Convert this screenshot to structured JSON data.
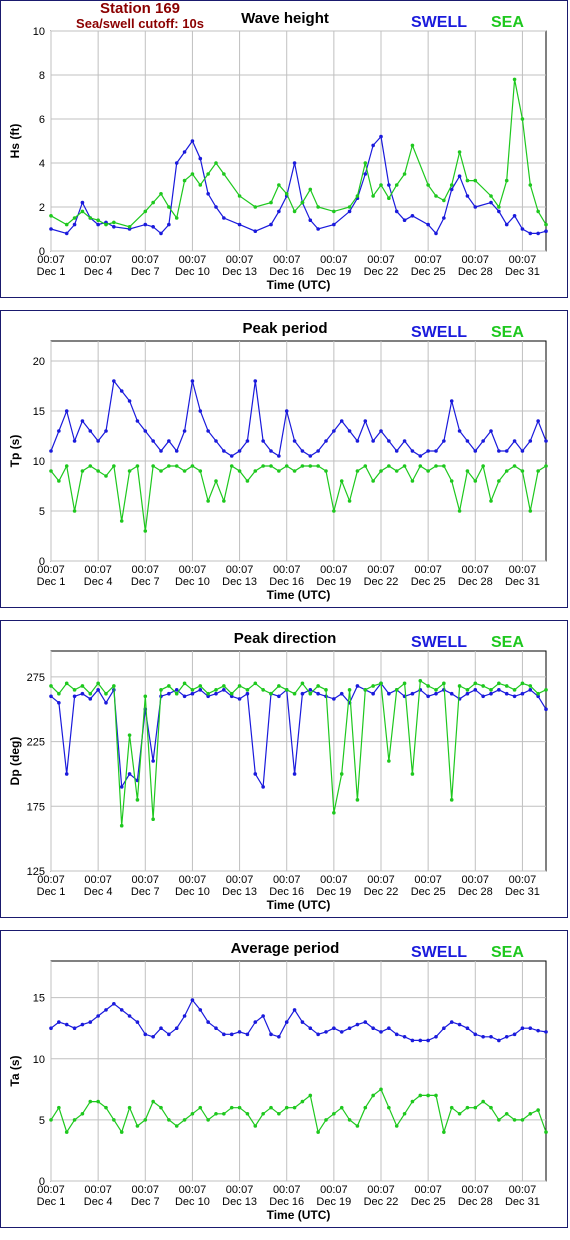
{
  "header": {
    "station": "Station 169",
    "cutoff": "Sea/swell cutoff: 10s"
  },
  "colors": {
    "swell": "#1a1adc",
    "sea": "#1ec81e",
    "frame": "#1a1a6e",
    "station": "#8b0000"
  },
  "legend": {
    "swell": "SWELL",
    "sea": "SEA"
  },
  "x_axis": {
    "label": "Time (UTC)",
    "tick_times": [
      "00:07",
      "00:07",
      "00:07",
      "00:07",
      "00:07",
      "00:07",
      "00:07",
      "00:07",
      "00:07",
      "00:07",
      "00:07"
    ],
    "tick_dates": [
      "Dec 1",
      "Dec 4",
      "Dec 7",
      "Dec 10",
      "Dec 13",
      "Dec 16",
      "Dec 19",
      "Dec 22",
      "Dec 25",
      "Dec 28",
      "Dec 31"
    ],
    "tick_days": [
      0,
      3,
      6,
      9,
      12,
      15,
      18,
      21,
      24,
      27,
      30
    ],
    "range_days": [
      0,
      31.5
    ]
  },
  "chart_data": [
    {
      "type": "line",
      "title": "Wave height",
      "ylabel": "Hs (ft)",
      "ylim": [
        0,
        10
      ],
      "yticks": [
        0,
        2,
        4,
        6,
        8,
        10
      ],
      "grid": true,
      "legend_position": "top-right",
      "x_days": [
        0,
        1,
        1.5,
        2,
        2.5,
        3,
        3.5,
        4,
        5,
        6,
        6.5,
        7,
        7.5,
        8,
        8.5,
        9,
        9.5,
        10,
        10.5,
        11,
        12,
        13,
        14,
        14.5,
        15,
        15.5,
        16,
        16.5,
        17,
        18,
        19,
        19.5,
        20,
        20.5,
        21,
        21.5,
        22,
        22.5,
        23,
        24,
        24.5,
        25,
        25.5,
        26,
        26.5,
        27,
        28,
        28.5,
        29,
        29.5,
        30,
        30.5,
        31,
        31.5
      ],
      "series": [
        {
          "name": "SWELL",
          "values": [
            1.0,
            0.8,
            1.2,
            2.2,
            1.5,
            1.2,
            1.3,
            1.1,
            1.0,
            1.2,
            1.1,
            0.8,
            1.2,
            4.0,
            4.5,
            5.0,
            4.2,
            2.6,
            2.0,
            1.5,
            1.2,
            0.9,
            1.2,
            1.8,
            2.5,
            4.0,
            2.2,
            1.4,
            1.0,
            1.2,
            1.8,
            2.4,
            3.5,
            4.8,
            5.2,
            3.0,
            1.8,
            1.4,
            1.6,
            1.2,
            0.8,
            1.5,
            2.8,
            3.4,
            2.5,
            2.0,
            2.2,
            1.8,
            1.2,
            1.6,
            1.0,
            0.8,
            0.8,
            0.9
          ]
        },
        {
          "name": "SEA",
          "values": [
            1.6,
            1.2,
            1.5,
            1.8,
            1.5,
            1.4,
            1.2,
            1.3,
            1.1,
            1.8,
            2.2,
            2.6,
            2.0,
            1.5,
            3.2,
            3.5,
            3.0,
            3.5,
            4.0,
            3.5,
            2.5,
            2.0,
            2.2,
            3.0,
            2.6,
            1.8,
            2.2,
            2.8,
            2.0,
            1.8,
            2.0,
            2.5,
            4.0,
            2.5,
            3.0,
            2.4,
            3.0,
            3.5,
            4.8,
            3.0,
            2.5,
            2.3,
            3.0,
            4.5,
            3.2,
            3.2,
            2.5,
            2.0,
            3.2,
            7.8,
            6.0,
            3.0,
            1.8,
            1.2
          ]
        }
      ]
    },
    {
      "type": "line",
      "title": "Peak period",
      "ylabel": "Tp (s)",
      "ylim": [
        0,
        22
      ],
      "yticks": [
        0,
        5,
        10,
        15,
        20
      ],
      "grid": true,
      "legend_position": "top-right",
      "x_days": [
        0,
        0.5,
        1,
        1.5,
        2,
        2.5,
        3,
        3.5,
        4,
        4.5,
        5,
        5.5,
        6,
        6.5,
        7,
        7.5,
        8,
        8.5,
        9,
        9.5,
        10,
        10.5,
        11,
        11.5,
        12,
        12.5,
        13,
        13.5,
        14,
        14.5,
        15,
        15.5,
        16,
        16.5,
        17,
        17.5,
        18,
        18.5,
        19,
        19.5,
        20,
        20.5,
        21,
        21.5,
        22,
        22.5,
        23,
        23.5,
        24,
        24.5,
        25,
        25.5,
        26,
        26.5,
        27,
        27.5,
        28,
        28.5,
        29,
        29.5,
        30,
        30.5,
        31,
        31.5
      ],
      "series": [
        {
          "name": "SWELL",
          "values": [
            11,
            13,
            15,
            12,
            14,
            13,
            12,
            13,
            18,
            17,
            16,
            14,
            13,
            12,
            11,
            12,
            11,
            13,
            18,
            15,
            13,
            12,
            11,
            10.5,
            11,
            12,
            18,
            12,
            11,
            10.5,
            15,
            12,
            11,
            10.5,
            11,
            12,
            13,
            14,
            13,
            12,
            14,
            12,
            13,
            12,
            11,
            12,
            11,
            10.5,
            11,
            11,
            12,
            16,
            13,
            12,
            11,
            12,
            13,
            11,
            11,
            12,
            11,
            12,
            14,
            12
          ]
        },
        {
          "name": "SEA",
          "values": [
            9,
            8,
            9.5,
            5,
            9,
            9.5,
            9,
            8.5,
            9.5,
            4,
            9,
            9.5,
            3,
            9.5,
            9,
            9.5,
            9.5,
            9,
            9.5,
            9,
            6,
            8,
            6,
            9.5,
            9,
            8,
            9,
            9.5,
            9.5,
            9,
            9.5,
            9,
            9.5,
            9.5,
            9.5,
            9,
            5,
            8,
            6,
            9,
            9.5,
            8,
            9,
            9.5,
            9,
            9.5,
            8,
            9.5,
            9,
            9.5,
            9.5,
            8,
            5,
            9,
            8,
            9.5,
            6,
            8,
            9,
            9.5,
            9,
            5,
            9,
            9.5
          ]
        }
      ]
    },
    {
      "type": "line",
      "title": "Peak direction",
      "ylabel": "Dp (deg)",
      "ylim": [
        125,
        295
      ],
      "yticks": [
        125,
        175,
        225,
        275
      ],
      "grid": true,
      "legend_position": "top-right",
      "x_days": [
        0,
        0.5,
        1,
        1.5,
        2,
        2.5,
        3,
        3.5,
        4,
        4.5,
        5,
        5.5,
        6,
        6.5,
        7,
        7.5,
        8,
        8.5,
        9,
        9.5,
        10,
        10.5,
        11,
        11.5,
        12,
        12.5,
        13,
        13.5,
        14,
        14.5,
        15,
        15.5,
        16,
        16.5,
        17,
        17.5,
        18,
        18.5,
        19,
        19.5,
        20,
        20.5,
        21,
        21.5,
        22,
        22.5,
        23,
        23.5,
        24,
        24.5,
        25,
        25.5,
        26,
        26.5,
        27,
        27.5,
        28,
        28.5,
        29,
        29.5,
        30,
        30.5,
        31,
        31.5
      ],
      "series": [
        {
          "name": "SWELL",
          "values": [
            260,
            255,
            200,
            260,
            262,
            258,
            265,
            255,
            265,
            190,
            200,
            195,
            250,
            210,
            260,
            262,
            265,
            260,
            262,
            265,
            260,
            262,
            265,
            260,
            258,
            262,
            200,
            190,
            262,
            260,
            265,
            200,
            262,
            265,
            262,
            260,
            258,
            262,
            255,
            268,
            265,
            262,
            270,
            262,
            265,
            260,
            262,
            265,
            260,
            262,
            265,
            262,
            258,
            262,
            265,
            260,
            262,
            265,
            262,
            260,
            262,
            265,
            260,
            250
          ]
        },
        {
          "name": "SEA",
          "values": [
            268,
            262,
            270,
            265,
            268,
            262,
            270,
            262,
            268,
            160,
            230,
            180,
            260,
            165,
            265,
            268,
            262,
            270,
            265,
            268,
            262,
            265,
            268,
            262,
            268,
            265,
            270,
            265,
            262,
            268,
            265,
            262,
            270,
            262,
            268,
            265,
            170,
            200,
            265,
            180,
            265,
            268,
            270,
            210,
            265,
            270,
            200,
            272,
            268,
            265,
            270,
            180,
            268,
            265,
            270,
            268,
            265,
            270,
            268,
            265,
            270,
            268,
            262,
            265
          ]
        }
      ]
    },
    {
      "type": "line",
      "title": "Average period",
      "ylabel": "Ta (s)",
      "ylim": [
        0,
        18
      ],
      "yticks": [
        0,
        5,
        10,
        15
      ],
      "grid": true,
      "legend_position": "top-right",
      "x_days": [
        0,
        0.5,
        1,
        1.5,
        2,
        2.5,
        3,
        3.5,
        4,
        4.5,
        5,
        5.5,
        6,
        6.5,
        7,
        7.5,
        8,
        8.5,
        9,
        9.5,
        10,
        10.5,
        11,
        11.5,
        12,
        12.5,
        13,
        13.5,
        14,
        14.5,
        15,
        15.5,
        16,
        16.5,
        17,
        17.5,
        18,
        18.5,
        19,
        19.5,
        20,
        20.5,
        21,
        21.5,
        22,
        22.5,
        23,
        23.5,
        24,
        24.5,
        25,
        25.5,
        26,
        26.5,
        27,
        27.5,
        28,
        28.5,
        29,
        29.5,
        30,
        30.5,
        31,
        31.5
      ],
      "series": [
        {
          "name": "SWELL",
          "values": [
            12.5,
            13,
            12.8,
            12.5,
            12.8,
            13,
            13.5,
            14,
            14.5,
            14,
            13.5,
            13,
            12,
            11.8,
            12.5,
            12,
            12.5,
            13.5,
            14.8,
            14,
            13,
            12.5,
            12,
            12,
            12.2,
            12,
            13,
            13.5,
            12,
            11.8,
            13,
            14,
            13,
            12.5,
            12,
            12.2,
            12.5,
            12.2,
            12.5,
            12.8,
            13,
            12.5,
            12.2,
            12.5,
            12,
            11.8,
            11.5,
            11.5,
            11.5,
            11.8,
            12.5,
            13,
            12.8,
            12.5,
            12,
            11.8,
            11.8,
            11.5,
            11.8,
            12,
            12.5,
            12.5,
            12.3,
            12.2
          ]
        },
        {
          "name": "SEA",
          "values": [
            5,
            6,
            4,
            5,
            5.5,
            6.5,
            6.5,
            6,
            5,
            4,
            6,
            4.5,
            5,
            6.5,
            6,
            5,
            4.5,
            5,
            5.5,
            6,
            5,
            5.5,
            5.5,
            6,
            6,
            5.5,
            4.5,
            5.5,
            6,
            5.5,
            6,
            6,
            6.5,
            7,
            4,
            5,
            5.5,
            6,
            5,
            4.5,
            6,
            7,
            7.5,
            6,
            4.5,
            5.5,
            6.5,
            7,
            7,
            7,
            4,
            6,
            5.5,
            6,
            6,
            6.5,
            6,
            5,
            5.5,
            5,
            5,
            5.5,
            5.8,
            4
          ]
        }
      ]
    }
  ]
}
